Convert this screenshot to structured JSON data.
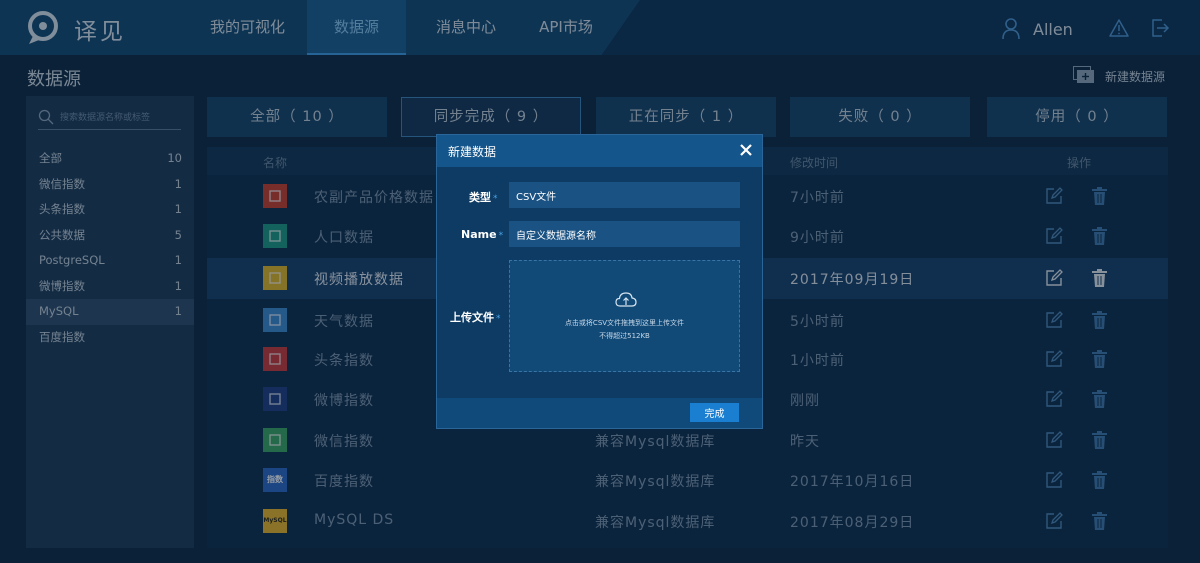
{
  "app": {
    "name": "译见"
  },
  "nav": {
    "items": [
      {
        "label": "我的可视化"
      },
      {
        "label": "数据源"
      },
      {
        "label": "消息中心"
      },
      {
        "label": "API市场"
      }
    ],
    "active_index": 1,
    "user_name": "Allen"
  },
  "page": {
    "title": "数据源",
    "new_button_label": "新建数据源"
  },
  "search": {
    "placeholder": "搜索数据源名称或标签"
  },
  "sidebar": {
    "items": [
      {
        "label": "全部",
        "count": "10"
      },
      {
        "label": "微信指数",
        "count": "1"
      },
      {
        "label": "头条指数",
        "count": "1"
      },
      {
        "label": "公共数据",
        "count": "5"
      },
      {
        "label": "PostgreSQL",
        "count": "1"
      },
      {
        "label": "微博指数",
        "count": "1"
      },
      {
        "label": "MySQL",
        "count": "1"
      },
      {
        "label": "百度指数",
        "count": ""
      }
    ],
    "active_index": 6
  },
  "tabs": [
    {
      "label": "全部（ 10 ）"
    },
    {
      "label": "同步完成（ 9 ）"
    },
    {
      "label": "正在同步（ 1 ）"
    },
    {
      "label": "失败（ 0 ）"
    },
    {
      "label": "停用（ 0 ）"
    }
  ],
  "active_tab": 1,
  "table": {
    "headers": {
      "name": "名称",
      "modified": "修改时间",
      "actions": "操作"
    },
    "rows": [
      {
        "name": "农副产品价格数据",
        "type": "",
        "time": "7小时前",
        "icon": "agri-icon",
        "color": "#c9412f"
      },
      {
        "name": "人口数据",
        "type": "",
        "time": "9小时前",
        "icon": "population-icon",
        "color": "#1d9a86"
      },
      {
        "name": "视频播放数据",
        "type": "",
        "time": "2017年09月19日",
        "icon": "video-icon",
        "color": "#e0b72a"
      },
      {
        "name": "天气数据",
        "type": "",
        "time": "5小时前",
        "icon": "weather-icon",
        "color": "#3b8ad1"
      },
      {
        "name": "头条指数",
        "type": "",
        "time": "1小时前",
        "icon": "toutiao-icon",
        "color": "#c93a3a"
      },
      {
        "name": "微博指数",
        "type": "",
        "time": "刚刚",
        "icon": "weibo-icon",
        "color": "#1f3f86"
      },
      {
        "name": "微信指数",
        "type": "兼容Mysql数据库",
        "time": "昨天",
        "icon": "wechat-icon",
        "color": "#3aa564"
      },
      {
        "name": "百度指数",
        "type": "兼容Mysql数据库",
        "time": "2017年10月16日",
        "icon": "baidu-icon",
        "color": "#2b68c7",
        "icon_text": "指数"
      },
      {
        "name": "MySQL DS",
        "type": "兼容Mysql数据库",
        "time": "2017年08月29日",
        "icon": "mysql-icon",
        "color": "#e8b52a",
        "icon_text": "MySQL"
      }
    ],
    "highlight_index": 2
  },
  "modal": {
    "title": "新建数据",
    "type_label": "类型",
    "type_value": "CSV文件",
    "name_label": "Name",
    "name_placeholder": "自定义数据源名称",
    "upload_label": "上传文件",
    "required_mark": "*",
    "upload_text_1": "点击或将CSV文件拖拽到这里上传文件",
    "upload_text_2": "不得超过512KB",
    "done_label": "完成"
  },
  "colors": {
    "accent": "#1a7fd0",
    "nav_bg": "#0d3559",
    "page_bg": "#0e2a45"
  }
}
